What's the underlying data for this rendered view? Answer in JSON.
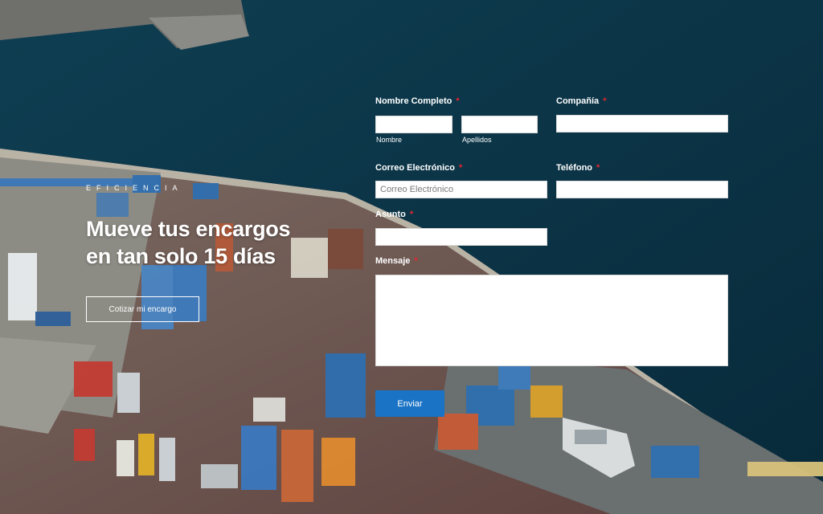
{
  "hero": {
    "eyebrow": "EFICIENCIA",
    "title_line1": "Mueve tus encargos",
    "title_line2": "en tan solo 15 días",
    "cta_label": "Cotizar mi encargo"
  },
  "form": {
    "full_name": {
      "label": "Nombre Completo",
      "first_name_sublabel": "Nombre",
      "last_name_sublabel": "Apellidos",
      "first_name_value": "",
      "last_name_value": ""
    },
    "company": {
      "label": "Compañía",
      "value": ""
    },
    "email": {
      "label": "Correo Electrónico",
      "placeholder": "Correo Electrónico",
      "value": ""
    },
    "phone": {
      "label": "Teléfono",
      "value": ""
    },
    "subject": {
      "label": "Asunto",
      "value": ""
    },
    "message": {
      "label": "Mensaje",
      "value": ""
    },
    "required_marker": "*",
    "submit_label": "Enviar"
  },
  "colors": {
    "sea": "#0b3446",
    "quay": "#8a8a85",
    "yard": "#6e4a44",
    "submit_button": "#1a73c4",
    "required": "#e8242f"
  }
}
